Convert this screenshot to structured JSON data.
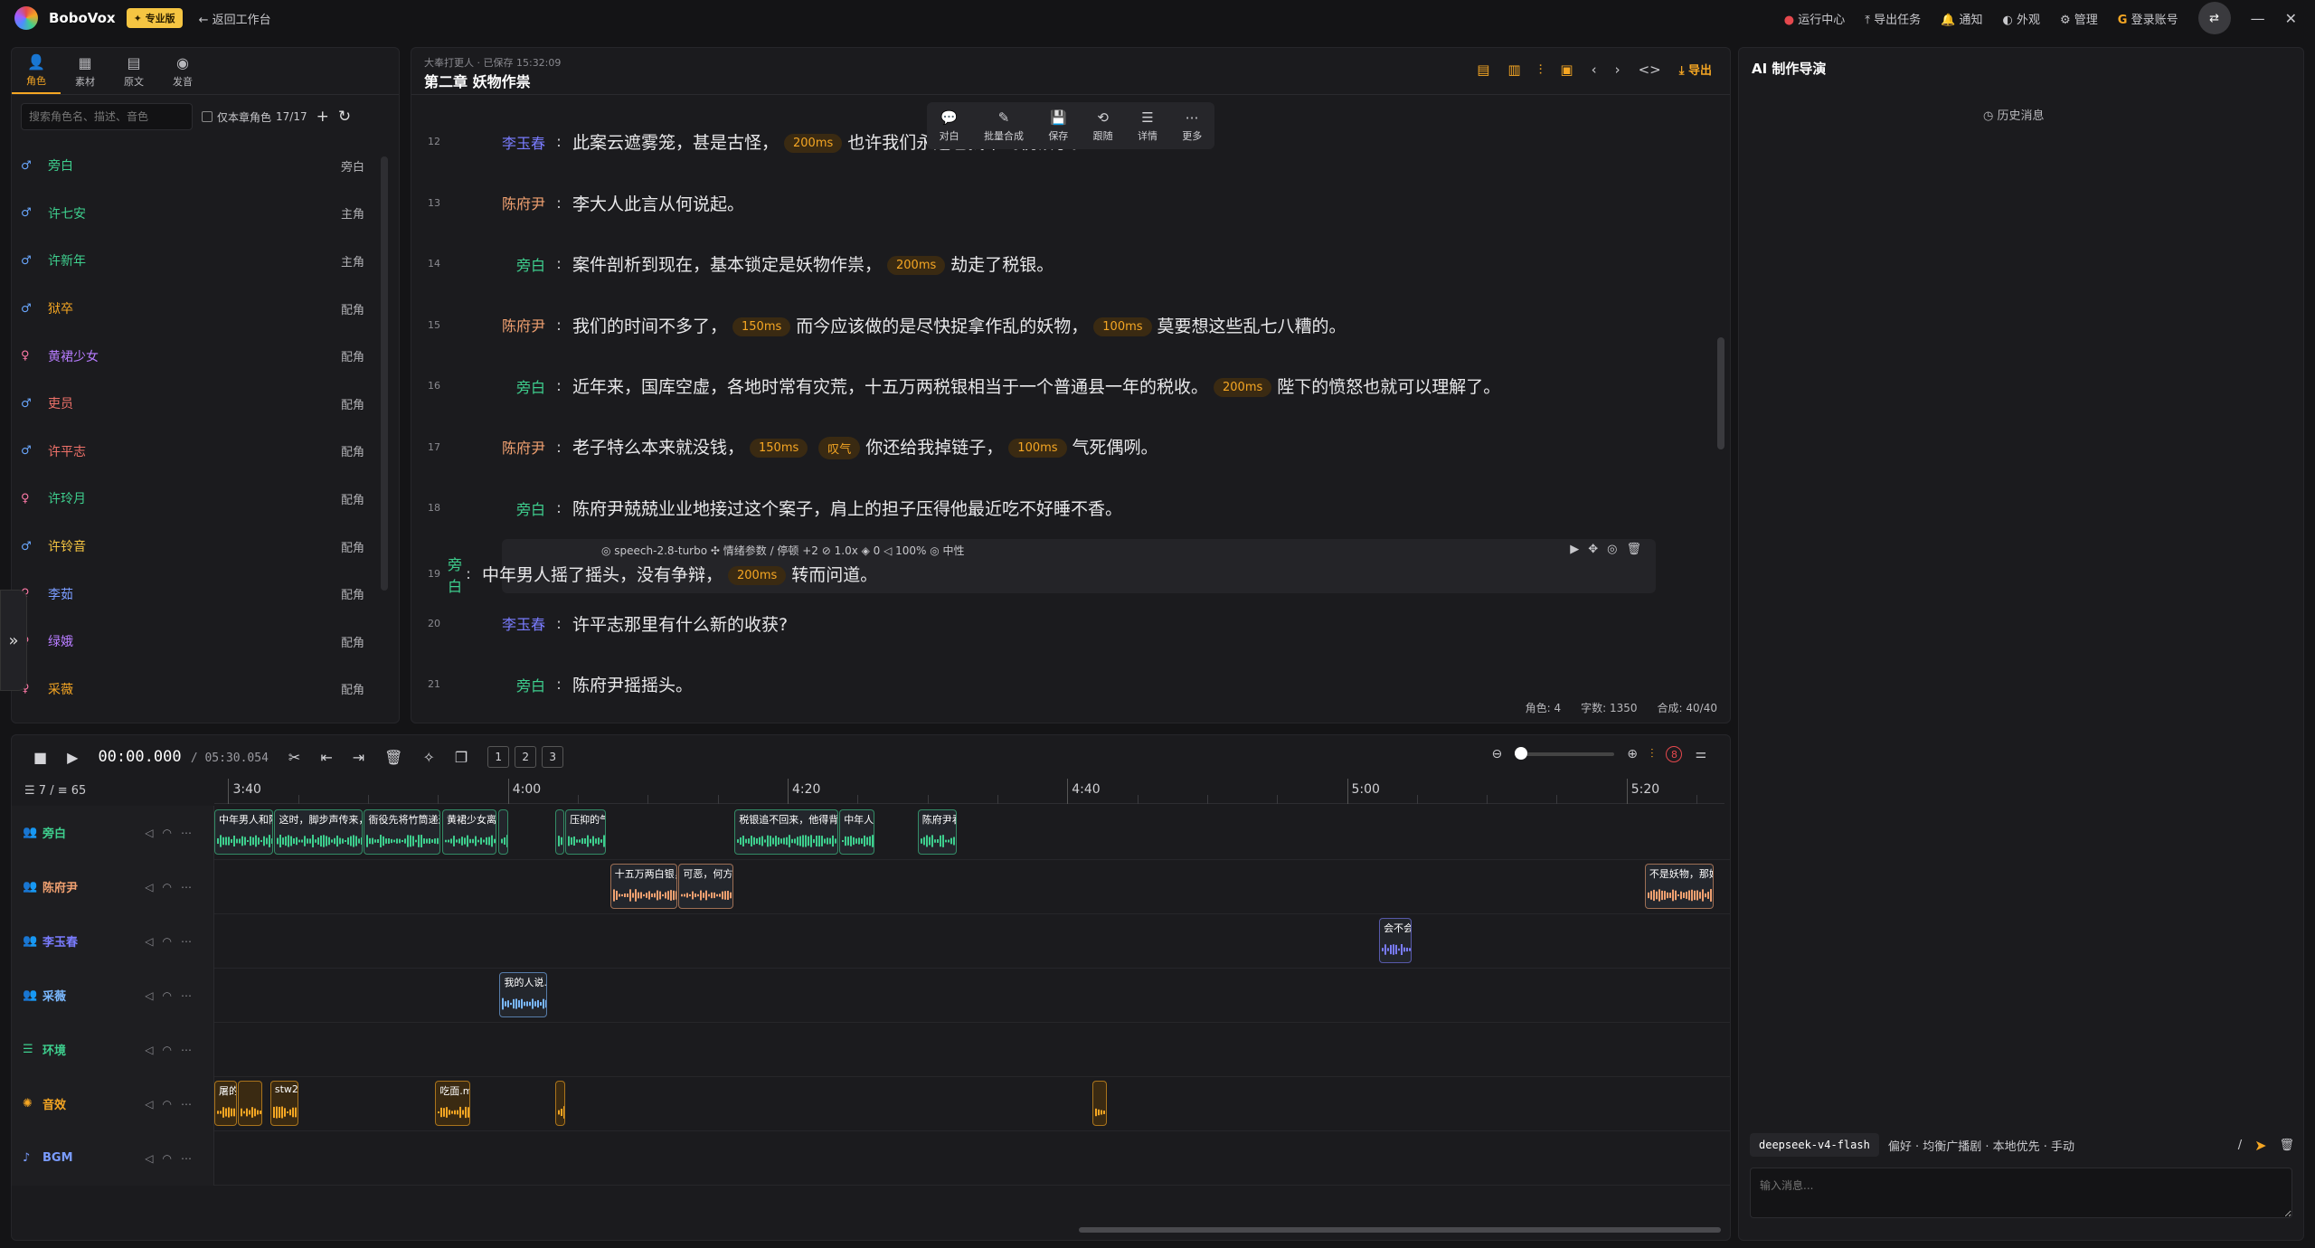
{
  "app": {
    "name": "BoboVox",
    "edition_badge": "✦ 专业版",
    "back_label": "← 返回工作台"
  },
  "topbar": {
    "items": [
      {
        "icon": "red-dot",
        "label": "运行中心"
      },
      {
        "icon": "export-task-icon",
        "label": "导出任务"
      },
      {
        "icon": "bell-icon",
        "label": "通知"
      },
      {
        "icon": "appearance-icon",
        "label": "外观"
      },
      {
        "icon": "gear-icon",
        "label": "管理"
      },
      {
        "icon": "g-icon",
        "label": "登录账号"
      }
    ]
  },
  "left": {
    "tabs": [
      {
        "icon": "person-icon",
        "label": "角色",
        "active": true
      },
      {
        "icon": "material-icon",
        "label": "素材",
        "active": false
      },
      {
        "icon": "document-icon",
        "label": "原文",
        "active": false
      },
      {
        "icon": "voice-icon",
        "label": "发音",
        "active": false
      }
    ],
    "search_placeholder": "搜索角色名、描述、音色",
    "only_chapter_label": "仅本章角色",
    "role_count": "17/17",
    "roles": [
      {
        "sex": "♂",
        "name": "旁白",
        "type": "旁白",
        "color": "#3ecf8e"
      },
      {
        "sex": "♂",
        "name": "许七安",
        "type": "主角",
        "color": "#3ecf8e"
      },
      {
        "sex": "♂",
        "name": "许新年",
        "type": "主角",
        "color": "#3ecf8e"
      },
      {
        "sex": "♂",
        "name": "狱卒",
        "type": "配角",
        "color": "#f5a623"
      },
      {
        "sex": "♀",
        "name": "黄裙少女",
        "type": "配角",
        "color": "#b77cff"
      },
      {
        "sex": "♂",
        "name": "吏员",
        "type": "配角",
        "color": "#f0726a"
      },
      {
        "sex": "♂",
        "name": "许平志",
        "type": "配角",
        "color": "#f0726a"
      },
      {
        "sex": "♀",
        "name": "许玲月",
        "type": "配角",
        "color": "#3ecf8e"
      },
      {
        "sex": "♂",
        "name": "许铃音",
        "type": "配角",
        "color": "#f5c542"
      },
      {
        "sex": "♀",
        "name": "李茹",
        "type": "配角",
        "color": "#7a9cff"
      },
      {
        "sex": "♀",
        "name": "绿娥",
        "type": "配角",
        "color": "#b77cff"
      },
      {
        "sex": "♀",
        "name": "采薇",
        "type": "配角",
        "color": "#f5a623"
      }
    ]
  },
  "editor": {
    "meta": "大奉打更人 · 已保存 15:32:09",
    "title": "第二章 妖物作祟",
    "export_label": "导出",
    "float_toolbar": [
      {
        "icon": "dialog-icon",
        "label": "对白"
      },
      {
        "icon": "batch-synth-icon",
        "label": "批量合成"
      },
      {
        "icon": "save-icon",
        "label": "保存"
      },
      {
        "icon": "follow-icon",
        "label": "跟随"
      },
      {
        "icon": "detail-icon",
        "label": "详情"
      },
      {
        "icon": "more-icon",
        "label": "更多"
      }
    ],
    "lines": [
      {
        "num": "12",
        "speaker": "李玉春",
        "color": "#7a7cff",
        "parts": [
          "此案云遮雾笼，甚是古怪，",
          "200ms",
          "也许我们永远也找不到税银了。"
        ]
      },
      {
        "num": "13",
        "speaker": "陈府尹",
        "color": "#f0a070",
        "parts": [
          "李大人此言从何说起。"
        ]
      },
      {
        "num": "14",
        "speaker": "旁白",
        "color": "#3ecf8e",
        "parts": [
          "案件剖析到现在，基本锁定是妖物作祟，",
          "200ms",
          "劫走了税银。"
        ]
      },
      {
        "num": "15",
        "speaker": "陈府尹",
        "color": "#f0a070",
        "parts": [
          "我们的时间不多了，",
          "150ms",
          "而今应该做的是尽快捉拿作乱的妖物，",
          "100ms",
          "莫要想这些乱七八糟的。"
        ]
      },
      {
        "num": "16",
        "speaker": "旁白",
        "color": "#3ecf8e",
        "parts": [
          "近年来，国库空虚，各地时常有灾荒，十五万两税银相当于一个普通县一年的税收。",
          "200ms",
          "陛下的愤怒也就可以理解了。"
        ]
      },
      {
        "num": "17",
        "speaker": "陈府尹",
        "color": "#f0a070",
        "parts": [
          "老子特么本来就没钱，",
          "150ms",
          "叹气",
          "你还给我掉链子，",
          "100ms",
          "气死偶咧。"
        ]
      },
      {
        "num": "18",
        "speaker": "旁白",
        "color": "#3ecf8e",
        "parts": [
          "陈府尹兢兢业业地接过这个案子，肩上的担子压得他最近吃不好睡不香。"
        ]
      },
      {
        "num": "19",
        "speaker": "旁白",
        "color": "#3ecf8e",
        "parts": [
          "中年男人摇了摇头，没有争辩，",
          "200ms",
          "转而问道。"
        ],
        "selected": true
      },
      {
        "num": "20",
        "speaker": "李玉春",
        "color": "#7a7cff",
        "parts": [
          "许平志那里有什么新的收获?"
        ]
      },
      {
        "num": "21",
        "speaker": "旁白",
        "color": "#3ecf8e",
        "parts": [
          "陈府尹摇摇头。"
        ]
      }
    ],
    "selected_meta": "◎ speech-2.8-turbo  ✣ 情绪参数 / 停顿 +2  ⊘ 1.0x  ◈ 0  ◁ 100%  ◎ 中性",
    "footer": {
      "roles": "角色: 4",
      "chars": "字数: 1350",
      "synth": "合成: 40/40"
    }
  },
  "timeline": {
    "current_time": "00:00.000",
    "duration": "/ 05:30.054",
    "track_buttons": [
      "1",
      "2",
      "3"
    ],
    "counts": "☰ 7 / ≡ 65",
    "badge_count": "8",
    "ruler": [
      {
        "label": "3:40",
        "sec": 220
      },
      {
        "label": "4:00",
        "sec": 240
      },
      {
        "label": "4:20",
        "sec": 260
      },
      {
        "label": "4:40",
        "sec": 280
      },
      {
        "label": "5:00",
        "sec": 300
      },
      {
        "label": "5:20",
        "sec": 320
      }
    ],
    "view_start_sec": 219,
    "view_end_sec": 327,
    "tracks": [
      {
        "name": "旁白",
        "icon": "people-icon",
        "color": "#3ecf8e",
        "clips": [
          {
            "start": 219,
            "end": 223.2,
            "label": "中年男人和陈府尹..."
          },
          {
            "start": 223.3,
            "end": 229.6,
            "label": "这时，脚步声传来，一位面..."
          },
          {
            "start": 229.7,
            "end": 235.2,
            "label": "衙役先将竹筒递过去，这..."
          },
          {
            "start": 235.3,
            "end": 239.2,
            "label": "黄裙少女离開..."
          },
          {
            "start": 239.3,
            "end": 240,
            "label": ""
          },
          {
            "start": 243.4,
            "end": 244,
            "label": ""
          },
          {
            "start": 244.1,
            "end": 247,
            "label": "压抑的气氛..."
          },
          {
            "start": 256.2,
            "end": 263.6,
            "label": "税银追不回来，他得背锅，皇上可..."
          },
          {
            "start": 263.7,
            "end": 266.2,
            "label": "中年人..."
          },
          {
            "start": 269.3,
            "end": 272.1,
            "label": "陈府尹看..."
          }
        ]
      },
      {
        "name": "陈府尹",
        "icon": "people-icon",
        "color": "#f0a070",
        "clips": [
          {
            "start": 247.3,
            "end": 252.1,
            "label": "十五万两白银，能带..."
          },
          {
            "start": 252.2,
            "end": 256.1,
            "label": "可恶，何方妖物..."
          },
          {
            "start": 321.3,
            "end": 326.2,
            "label": "不是妖物，那妖风怎..."
          }
        ]
      },
      {
        "name": "李玉春",
        "icon": "people-icon",
        "color": "#7a7cff",
        "clips": [
          {
            "start": 302.3,
            "end": 304.6,
            "label": "会不会..."
          }
        ]
      },
      {
        "name": "采薇",
        "icon": "people-icon",
        "color": "#7ab8ff",
        "clips": [
          {
            "start": 239.4,
            "end": 242.8,
            "label": "我的人说..."
          }
        ]
      },
      {
        "name": "环境",
        "icon": "list-icon",
        "color": "#3ecf8e",
        "clips": []
      },
      {
        "name": "音效",
        "icon": "sfx-icon",
        "color": "#f5a623",
        "clips": [
          {
            "start": 219,
            "end": 220.6,
            "label": "屠的一..."
          },
          {
            "start": 220.7,
            "end": 222.4,
            "label": ""
          },
          {
            "start": 223,
            "end": 225,
            "label": "stw2..."
          },
          {
            "start": 234.8,
            "end": 237.3,
            "label": "吃面.mp3"
          },
          {
            "start": 243.4,
            "end": 244.1,
            "label": ""
          },
          {
            "start": 281.8,
            "end": 282.8,
            "label": ""
          }
        ]
      },
      {
        "name": "BGM",
        "icon": "music-icon",
        "color": "#7a9cff",
        "clips": []
      }
    ]
  },
  "ai": {
    "title": "AI 制作导演",
    "history_label": "◷ 历史消息",
    "model": "deepseek-v4-flash",
    "prefs": "偏好 · 均衡广播剧 · 本地优先 · 手动",
    "input_placeholder": "输入消息..."
  }
}
